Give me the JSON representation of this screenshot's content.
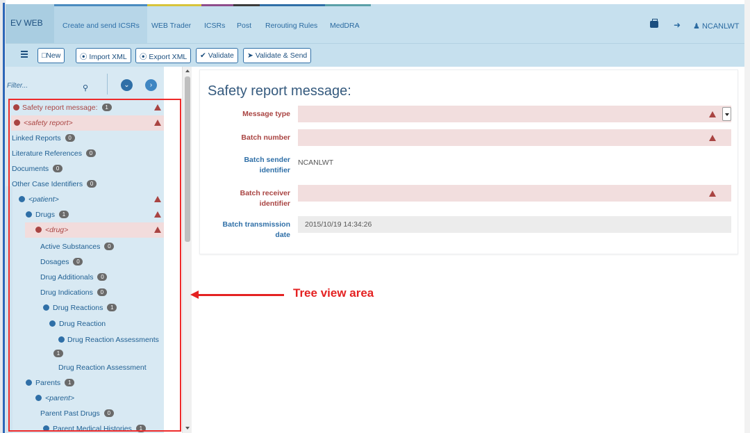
{
  "nav": {
    "brand": "EV WEB",
    "items": [
      "Create and send ICSRs",
      "WEB Trader",
      "ICSRs",
      "Post",
      "Rerouting Rules",
      "MedDRA"
    ],
    "user": "NCANLWT",
    "stripe_colors": [
      "#4a8bbf",
      "#d7c43b",
      "#8f4d8b",
      "#3b3b3b",
      "#2f6fa7",
      "#5aa0a8"
    ]
  },
  "toolbar": {
    "menu_icon": "hamburger-icon",
    "new": "New",
    "import": "Import XML",
    "export": "Export XML",
    "validate": "Validate",
    "validate_send": "Validate & Send"
  },
  "tree": {
    "filter_placeholder": "Filter...",
    "items": [
      {
        "label": "Safety report message:",
        "badge": "1",
        "warn": true
      },
      {
        "label": "<safety report>",
        "warn": true
      },
      {
        "label": "Linked Reports",
        "badge": "0"
      },
      {
        "label": "Literature References",
        "badge": "0"
      },
      {
        "label": "Documents",
        "badge": "0"
      },
      {
        "label": "Other Case Identifiers",
        "badge": "0"
      },
      {
        "label": "<patient>",
        "warn": true
      },
      {
        "label": "Drugs",
        "badge": "1",
        "warn": true
      },
      {
        "label": "<drug>",
        "warn": true
      },
      {
        "label": "Active Substances",
        "badge": "0"
      },
      {
        "label": "Dosages",
        "badge": "0"
      },
      {
        "label": "Drug Additionals",
        "badge": "0"
      },
      {
        "label": "Drug Indications",
        "badge": "0"
      },
      {
        "label": "Drug Reactions",
        "badge": "1"
      },
      {
        "label": "Drug Reaction"
      },
      {
        "label": "Drug Reaction Assessments",
        "badge": "1"
      },
      {
        "label": "Drug Reaction Assessment"
      },
      {
        "label": "Parents",
        "badge": "1"
      },
      {
        "label": "<parent>"
      },
      {
        "label": "Parent Past Drugs",
        "badge": "0"
      },
      {
        "label": "Parent Medical Histories",
        "badge": "1"
      }
    ]
  },
  "main": {
    "title": "Safety report message:",
    "fields": [
      {
        "label": "Message type",
        "value": ""
      },
      {
        "label": "Batch number",
        "value": ""
      },
      {
        "label": "Batch sender identifier",
        "value": "NCANLWT"
      },
      {
        "label": "Batch receiver identifier",
        "value": ""
      },
      {
        "label": "Batch transmission date",
        "value": "2015/10/19 14:34:26"
      }
    ]
  },
  "annotation": {
    "text": "Tree view area",
    "color": "#e42222"
  }
}
